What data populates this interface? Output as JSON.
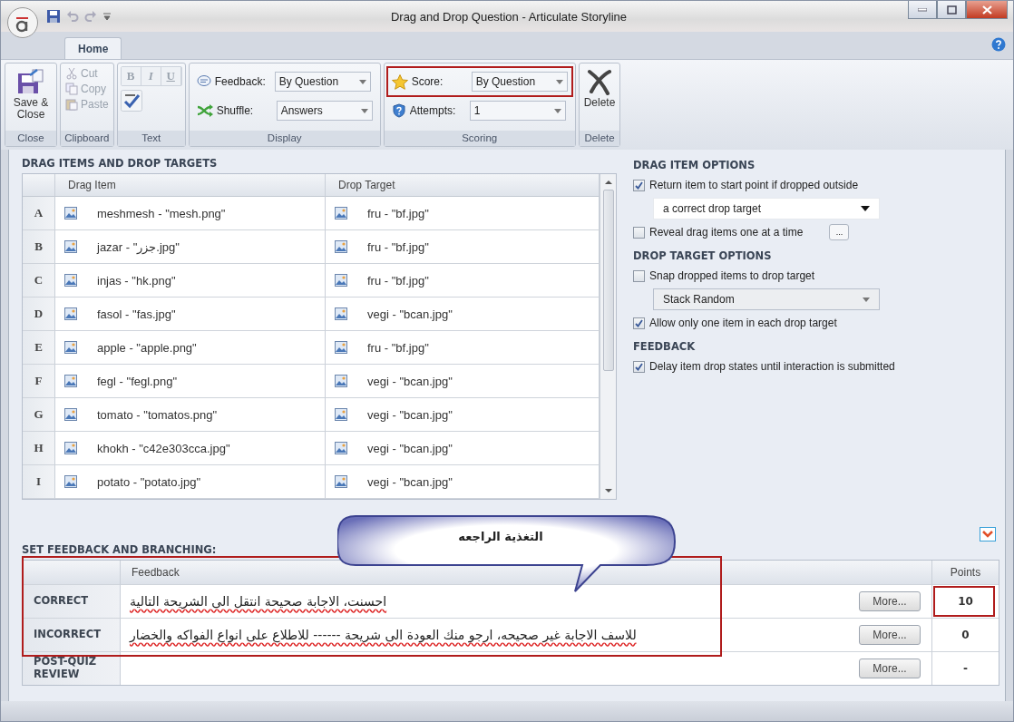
{
  "window": {
    "title": "Drag and Drop Question - Articulate Storyline"
  },
  "tabs": [
    {
      "label": "Home",
      "selected": true
    }
  ],
  "ribbon": {
    "close": {
      "button": "Save & Close",
      "label": "Close"
    },
    "clipboard": {
      "items": [
        {
          "label": "Cut",
          "disabled": true
        },
        {
          "label": "Copy",
          "disabled": true
        },
        {
          "label": "Paste",
          "disabled": true
        }
      ],
      "label": "Clipboard"
    },
    "text": {
      "format_buttons": [
        "B",
        "I",
        "U"
      ],
      "label": "Text"
    },
    "display": {
      "rows": [
        {
          "label": "Feedback:",
          "value": "By Question"
        },
        {
          "label": "Shuffle:",
          "value": "Answers"
        }
      ],
      "label": "Display"
    },
    "scoring": {
      "rows": [
        {
          "label": "Score:",
          "value": "By Question",
          "highlighted": true
        },
        {
          "label": "Attempts:",
          "value": "1",
          "highlighted": false
        }
      ],
      "label": "Scoring"
    },
    "delete": {
      "button": "Delete",
      "label": "Delete"
    }
  },
  "drag_table": {
    "title": "DRAG ITEMS AND DROP TARGETS",
    "columns": [
      "Drag Item",
      "Drop Target"
    ],
    "rows": [
      {
        "key": "A",
        "drag_item": "meshmesh - \"mesh.png\"",
        "drop_target": "fru - \"bf.jpg\""
      },
      {
        "key": "B",
        "drag_item": "jazar - \"جزر.jpg\"",
        "drop_target": "fru - \"bf.jpg\""
      },
      {
        "key": "C",
        "drag_item": "injas - \"hk.png\"",
        "drop_target": "fru - \"bf.jpg\""
      },
      {
        "key": "D",
        "drag_item": "fasol - \"fas.jpg\"",
        "drop_target": "vegi - \"bcan.jpg\""
      },
      {
        "key": "E",
        "drag_item": "apple - \"apple.png\"",
        "drop_target": "fru - \"bf.jpg\""
      },
      {
        "key": "F",
        "drag_item": "fegl - \"fegl.png\"",
        "drop_target": "vegi - \"bcan.jpg\""
      },
      {
        "key": "G",
        "drag_item": "tomato - \"tomatos.png\"",
        "drop_target": "vegi - \"bcan.jpg\""
      },
      {
        "key": "H",
        "drag_item": "khokh - \"c42e303cca.jpg\"",
        "drop_target": "vegi - \"bcan.jpg\""
      },
      {
        "key": "I",
        "drag_item": "potato - \"potato.jpg\"",
        "drop_target": "vegi - \"bcan.jpg\""
      }
    ]
  },
  "options": [
    {
      "title": "DRAG ITEM OPTIONS",
      "controls": [
        {
          "kind": "checkbox",
          "label": "Return item to start point if dropped outside",
          "checked": true
        },
        {
          "kind": "dropdown",
          "value": "a correct drop target",
          "disabled": false
        },
        {
          "kind": "checkbox",
          "label": "Reveal drag items one at a time",
          "checked": false,
          "button": "..."
        }
      ]
    },
    {
      "title": "DROP TARGET OPTIONS",
      "controls": [
        {
          "kind": "checkbox",
          "label": "Snap dropped items to drop target",
          "checked": false
        },
        {
          "kind": "dropdown",
          "value": "Stack Random",
          "disabled": true
        },
        {
          "kind": "checkbox",
          "label": "Allow only one item in each drop target",
          "checked": true
        }
      ]
    },
    {
      "title": "FEEDBACK",
      "controls": [
        {
          "kind": "checkbox",
          "label": "Delay item drop states until interaction is submitted",
          "checked": true
        }
      ]
    }
  ],
  "feedback": {
    "title": "SET FEEDBACK AND BRANCHING:",
    "columns": [
      "Feedback",
      "Points"
    ],
    "rows": [
      {
        "label": "CORRECT",
        "text": "احسنت، الاجابة صحيحة انتقل الى الشريحة التالية",
        "more": "More...",
        "points": "10",
        "highlighted": true
      },
      {
        "label": "INCORRECT",
        "text": "للاسف الاجابة غير صحيحه، ارجو منك العودة الى شريحة ------ للاطلاع على انواع الفواكه والخضار",
        "more": "More...",
        "points": "0",
        "highlighted": false
      },
      {
        "label": "POST-QUIZ REVIEW",
        "more": "More...",
        "points": "-",
        "highlighted": false
      }
    ]
  },
  "callout": {
    "text": "التغذية الراجعه"
  }
}
